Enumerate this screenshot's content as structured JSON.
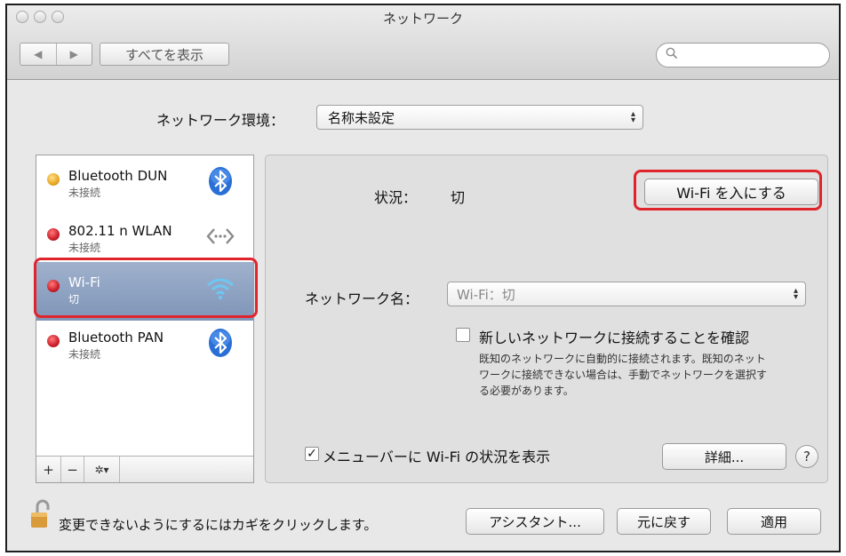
{
  "window": {
    "title": "ネットワーク"
  },
  "toolbar": {
    "back_label": "◀",
    "forward_label": "▶",
    "show_all_label": "すべてを表示",
    "search_placeholder": ""
  },
  "location": {
    "label": "ネットワーク環境：",
    "value": "名称未設定"
  },
  "services": [
    {
      "name": "Bluetooth DUN",
      "status": "未接続",
      "dot_color": "#e8a823",
      "icon": "bluetooth-icon"
    },
    {
      "name": "802.11 n WLAN",
      "status": "未接続",
      "dot_color": "#cc1e2a",
      "icon": "ethernet-arrows-icon"
    },
    {
      "name": "Wi-Fi",
      "status": "切",
      "dot_color": "#cc1e2a",
      "icon": "wifi-icon"
    },
    {
      "name": "Bluetooth PAN",
      "status": "未接続",
      "dot_color": "#cc1e2a",
      "icon": "bluetooth-icon"
    }
  ],
  "sidebar_toolbar": {
    "add": "+",
    "remove": "−",
    "gear": "✲▾"
  },
  "detail": {
    "status_label": "状況：",
    "status_value": "切",
    "wifi_button": "Wi-Fi を入にする",
    "network_name_label": "ネットワーク名：",
    "network_name_value": "Wi-Fi：切",
    "ask_join_label": "新しいネットワークに接続することを確認",
    "ask_join_desc_1": "既知のネットワークに自動的に接続されます。既知のネット",
    "ask_join_desc_2": "ワークに接続できない場合は、手動でネットワークを選択す",
    "ask_join_desc_3": "る必要があります。",
    "menubar_label": "メニューバーに Wi-Fi の状況を表示",
    "menubar_checked": "✓",
    "advanced_button": "詳細...",
    "help_label": "?"
  },
  "footer": {
    "lock_text": "変更できないようにするにはカギをクリックします。",
    "assistant_button": "アシスタント...",
    "revert_button": "元に戻す",
    "apply_button": "適用"
  },
  "colors": {
    "highlight": "#e0242c",
    "selected_row": "#8ea1c1"
  }
}
